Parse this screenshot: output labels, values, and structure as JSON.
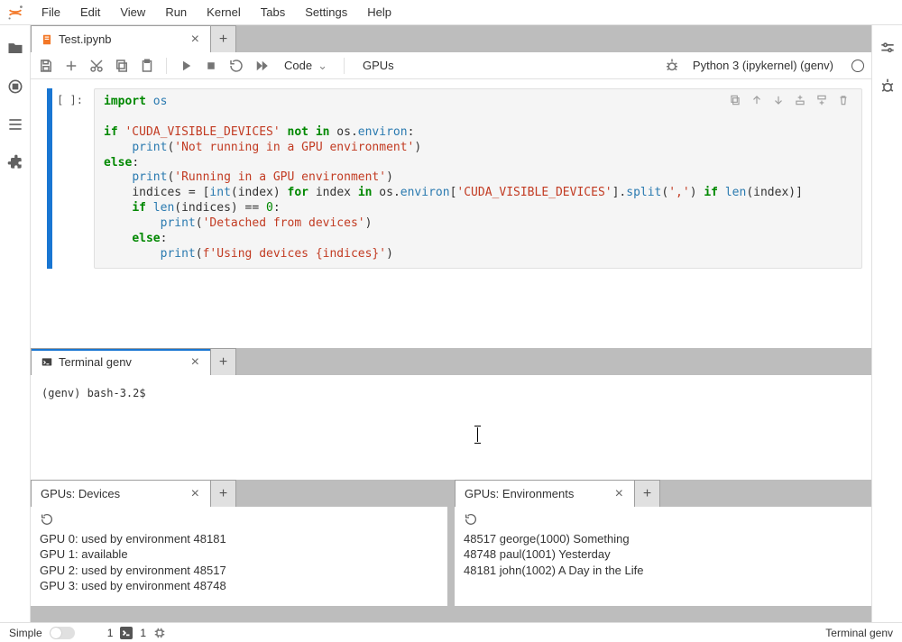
{
  "menubar": [
    "File",
    "Edit",
    "View",
    "Run",
    "Kernel",
    "Tabs",
    "Settings",
    "Help"
  ],
  "tabs": {
    "notebook": {
      "label": "Test.ipynb"
    },
    "terminal": {
      "label": "Terminal genv"
    },
    "devices": {
      "label": "GPUs: Devices"
    },
    "envs": {
      "label": "GPUs: Environments"
    }
  },
  "toolbar": {
    "celltype": "Code",
    "gpus_label": "GPUs",
    "kernel": "Python 3 (ipykernel) (genv)"
  },
  "cell": {
    "prompt": "[ ]:",
    "code": {
      "l1_import": "import",
      "l1_os": "os",
      "l2_if": "if",
      "l2_str": "'CUDA_VISIBLE_DEVICES'",
      "l2_not": "not",
      "l2_in": "in",
      "l2_os": "os",
      "l2_environ": "environ",
      "l2_colon": ":",
      "l3_print": "print",
      "l3_str": "'Not running in a GPU environment'",
      "l4_else": "else",
      "l4_colon": ":",
      "l5_print": "print",
      "l5_str": "'Running in a GPU environment'",
      "l6_indices": "indices",
      "l6_eq": " = [",
      "l6_int": "int",
      "l6_index1": "index",
      "l6_rp": ")",
      "l6_for": "for",
      "l6_index2": "index",
      "l6_in": "in",
      "l6_os": "os",
      "l6_environ": "environ",
      "l6_lb": "[",
      "l6_key": "'CUDA_VISIBLE_DEVICES'",
      "l6_rb": "]",
      "l6_split": "split",
      "l6_comma": "','",
      "l6_rp2": ")",
      "l6_if": "if",
      "l6_len": "len",
      "l6_index3": "index",
      "l6_rp3": ")]",
      "l7_if": "if",
      "l7_len": "len",
      "l7_indices": "indices",
      "l7_rp": ")",
      "l7_eqeq": " == ",
      "l7_zero": "0",
      "l7_colon": ":",
      "l8_print": "print",
      "l8_str": "'Detached from devices'",
      "l9_else": "else",
      "l9_colon": ":",
      "l10_print": "print",
      "l10_fstr": "f'Using devices {indices}'"
    }
  },
  "terminal": {
    "prompt": "(genv) bash-3.2$ "
  },
  "devices": [
    "GPU 0: used by environment 48181",
    "GPU 1: available",
    "GPU 2: used by environment 48517",
    "GPU 3: used by environment 48748"
  ],
  "envs": [
    "48517 george(1000) Something",
    "48748 paul(1001) Yesterday",
    "48181 john(1002) A Day in the Life"
  ],
  "status": {
    "simple": "Simple",
    "one_a": "1",
    "one_b": "1",
    "right": "Terminal genv"
  }
}
